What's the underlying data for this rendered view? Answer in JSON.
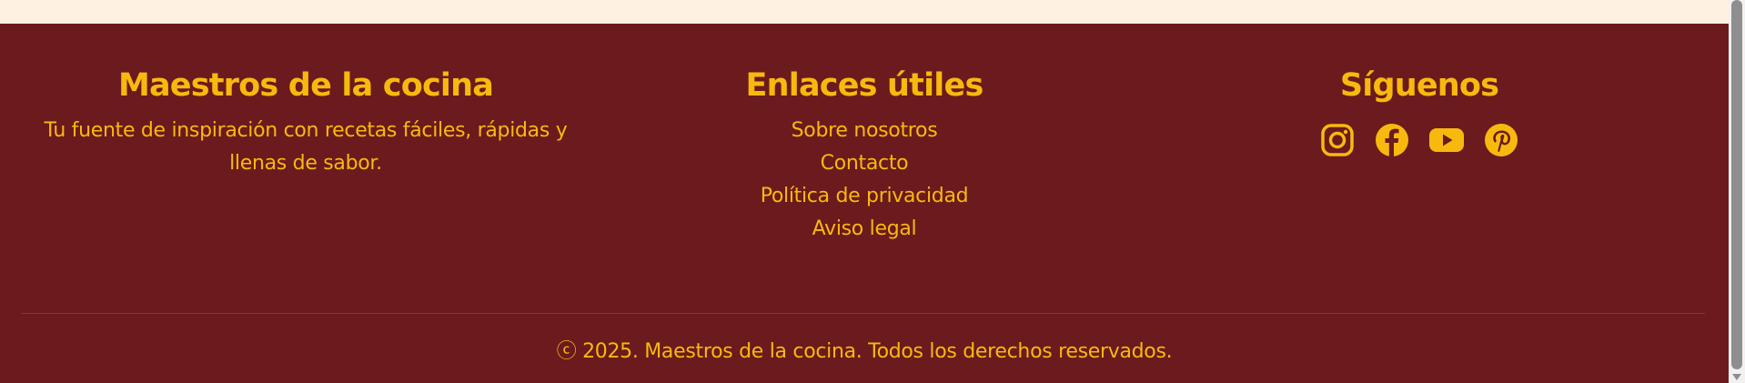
{
  "brand": {
    "title": "Maestros de la cocina",
    "description": "Tu fuente de inspiración con recetas fáciles, rápidas y llenas de sabor."
  },
  "links_section": {
    "title": "Enlaces útiles",
    "items": [
      {
        "label": "Sobre nosotros"
      },
      {
        "label": "Contacto"
      },
      {
        "label": "Política de privacidad"
      },
      {
        "label": "Aviso legal"
      }
    ]
  },
  "social": {
    "title": "Síguenos",
    "icons": [
      "instagram-icon",
      "facebook-icon",
      "youtube-icon",
      "pinterest-icon"
    ]
  },
  "copyright": "ⓒ 2025. Maestros de la cocina. Todos los derechos reservados.",
  "colors": {
    "footer_bg": "#6b1b1d",
    "accent": "#f8b90f",
    "top_strip": "#fef1e1"
  }
}
